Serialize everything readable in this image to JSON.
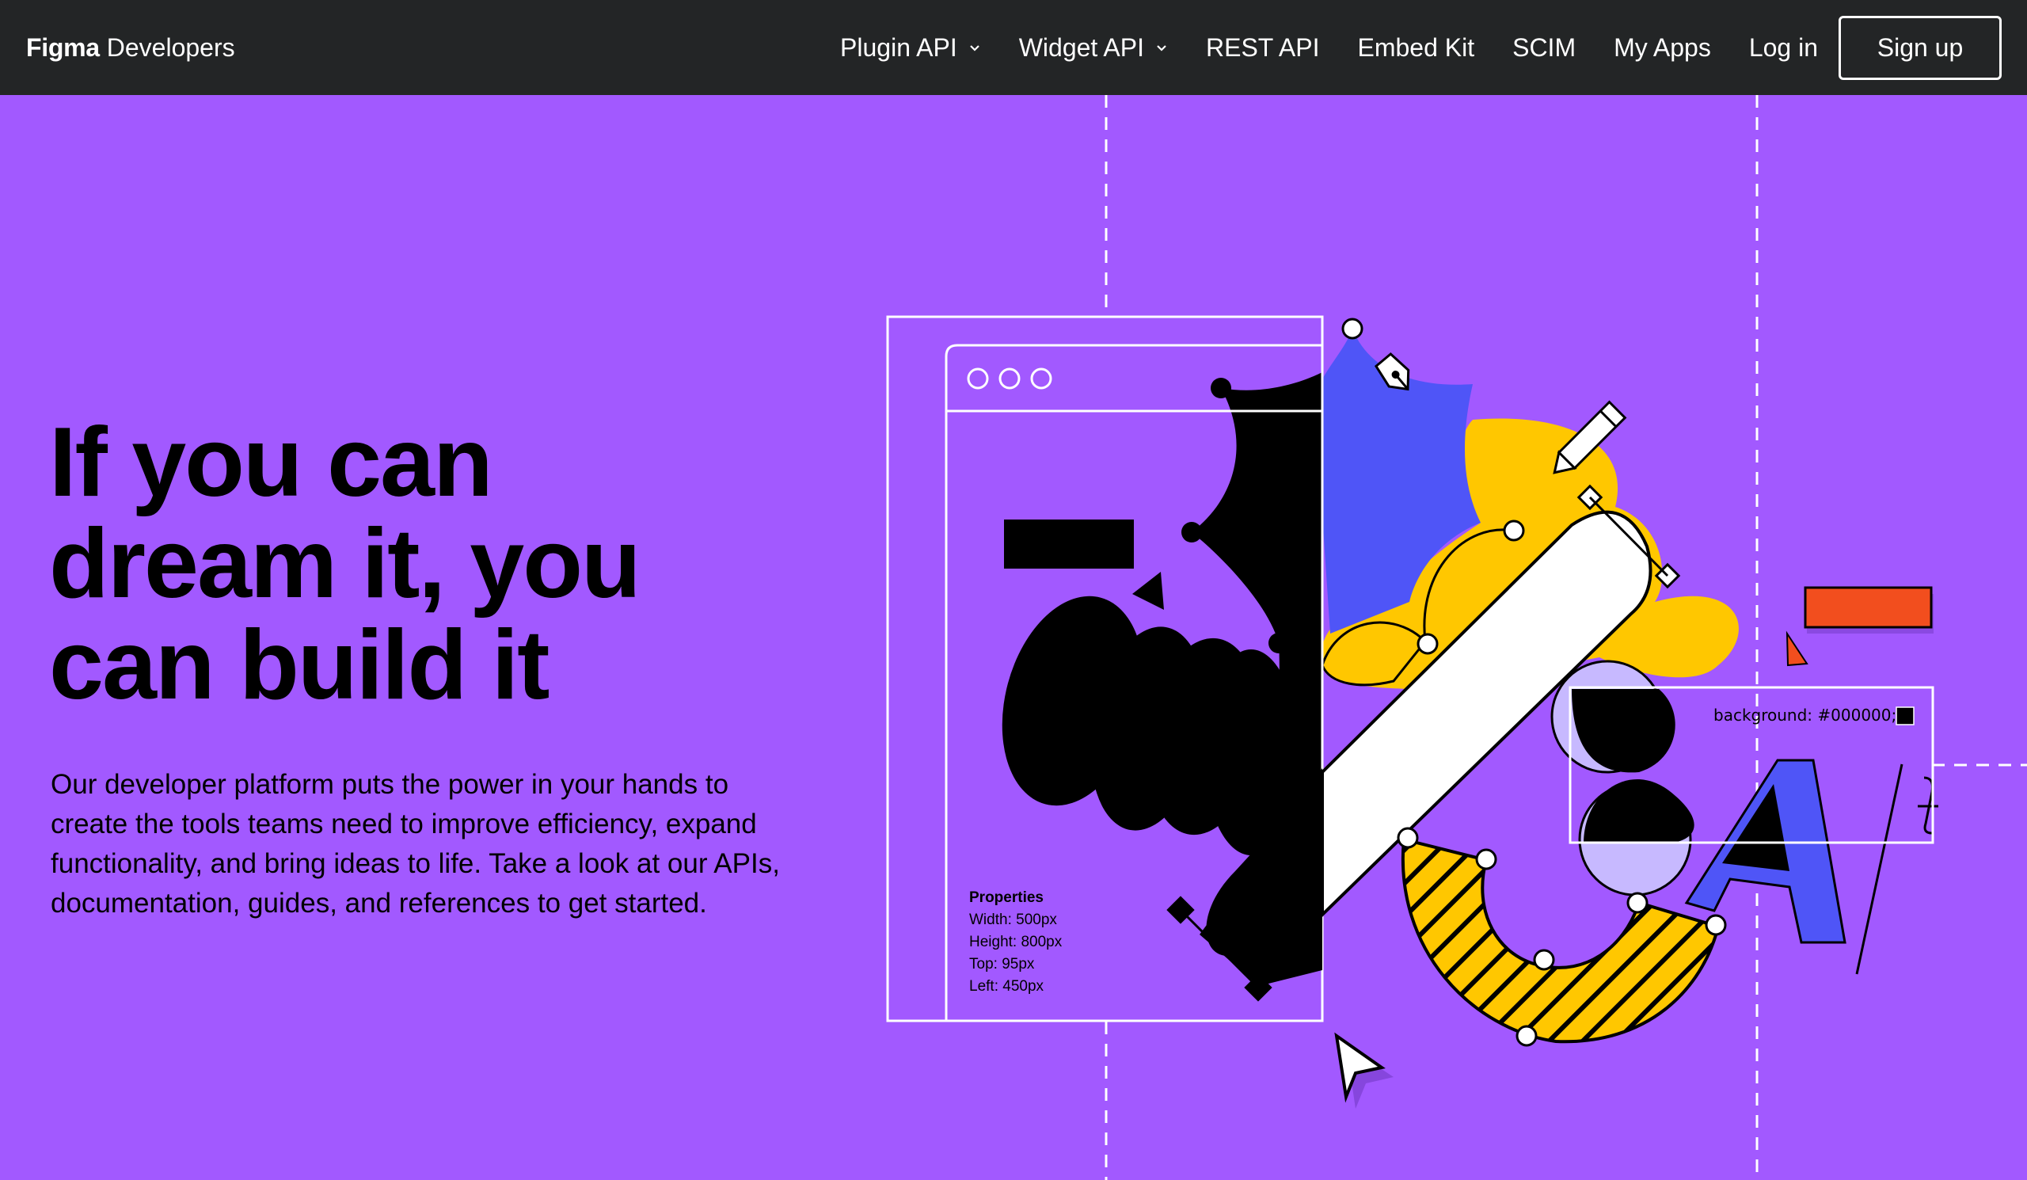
{
  "header": {
    "brand_bold": "Figma",
    "brand_rest": "Developers",
    "nav": [
      {
        "label": "Plugin API",
        "has_dropdown": true
      },
      {
        "label": "Widget API",
        "has_dropdown": true
      },
      {
        "label": "REST API",
        "has_dropdown": false
      },
      {
        "label": "Embed Kit",
        "has_dropdown": false
      },
      {
        "label": "SCIM",
        "has_dropdown": false
      },
      {
        "label": "My Apps",
        "has_dropdown": false
      },
      {
        "label": "Log in",
        "has_dropdown": false
      }
    ],
    "signup_label": "Sign up"
  },
  "hero": {
    "title_line1": "If you can",
    "title_line2": "dream it, you",
    "title_line3": "can build it",
    "description": "Our developer platform puts the power in your hands to create the tools teams need to improve efficiency, expand functionality, and bring ideas to life. Take a look at our APIs, documentation, guides, and references to get started."
  },
  "illustration": {
    "properties": {
      "heading": "Properties",
      "width": "Width: 500px",
      "height": "Height: 800px",
      "top": "Top: 95px",
      "left": "Left: 450px"
    },
    "background_label": "background: #000000;"
  },
  "colors": {
    "page_bg": "#a259ff",
    "nav_bg": "#232526",
    "blue": "#4f55f7",
    "yellow": "#ffc700",
    "red": "#f24e1e",
    "lavender": "#c7b9ff"
  }
}
